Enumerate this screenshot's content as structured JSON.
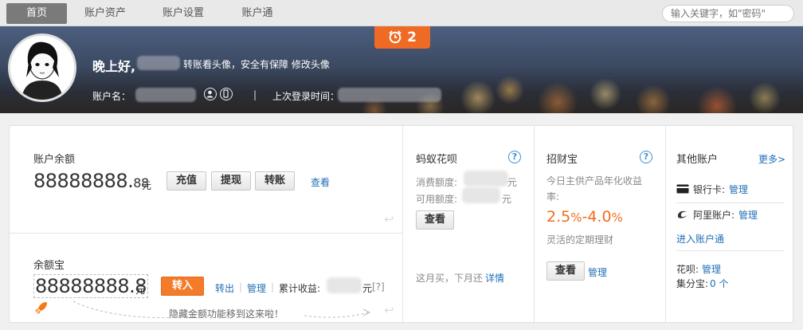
{
  "nav": {
    "tabs": [
      "首页",
      "账户资产",
      "账户设置",
      "账户通"
    ],
    "search_placeholder": "输入关键字，如\"密码\""
  },
  "banner": {
    "greeting": "晚上好,",
    "greeting_tail": "转账看头像，安全有保障",
    "edit_avatar": "修改头像",
    "account_label": "账户名：",
    "separator": "|",
    "last_login_label": "上次登录时间：",
    "alarm_count": "2"
  },
  "balance": {
    "label": "账户余额",
    "amount_int": "88888888.",
    "amount_dec": "88",
    "unit": "元",
    "buttons": [
      "充值",
      "提现",
      "转账"
    ],
    "view": "查看"
  },
  "yuebao": {
    "label": "余额宝",
    "amount_int": "88888888.8",
    "unit": "元",
    "transfer_in": "转入",
    "transfer_out": "转出",
    "manage": "管理",
    "divider": "|",
    "cumulative_label": "累计收益:",
    "cumulative_unit": "元",
    "help": "[?]",
    "hint": "隐藏金额功能移到这来啦！"
  },
  "huabei": {
    "title": "蚂蚁花呗",
    "help": "?",
    "consume_label": "消费额度:",
    "available_label": "可用额度:",
    "unit": "元",
    "view": "查看",
    "slogan": "这月买，下月还",
    "detail": "详情"
  },
  "zhaocaibao": {
    "title": "招财宝",
    "help": "?",
    "desc": "今日主供产品年化收益率:",
    "rate_a": "2.5",
    "rate_pct_a": "%",
    "rate_dash": "-",
    "rate_b": "4.0",
    "rate_pct_b": "%",
    "sub": "灵活的定期理财",
    "view": "查看",
    "manage": "管理"
  },
  "other": {
    "title": "其他账户",
    "more": "更多>",
    "bank_card_label": "银行卡:",
    "bank_card_manage": "管理",
    "alibaba_label": "阿里账户:",
    "alibaba_manage": "管理",
    "enter_link": "进入账户通",
    "huabei_label": "花呗:",
    "huabei_manage": "管理",
    "jifenbao_label": "集分宝:",
    "jifenbao_value": "0 个"
  },
  "colors": {
    "accent_orange": "#f37b2a",
    "link_blue": "#1f6fb7"
  }
}
